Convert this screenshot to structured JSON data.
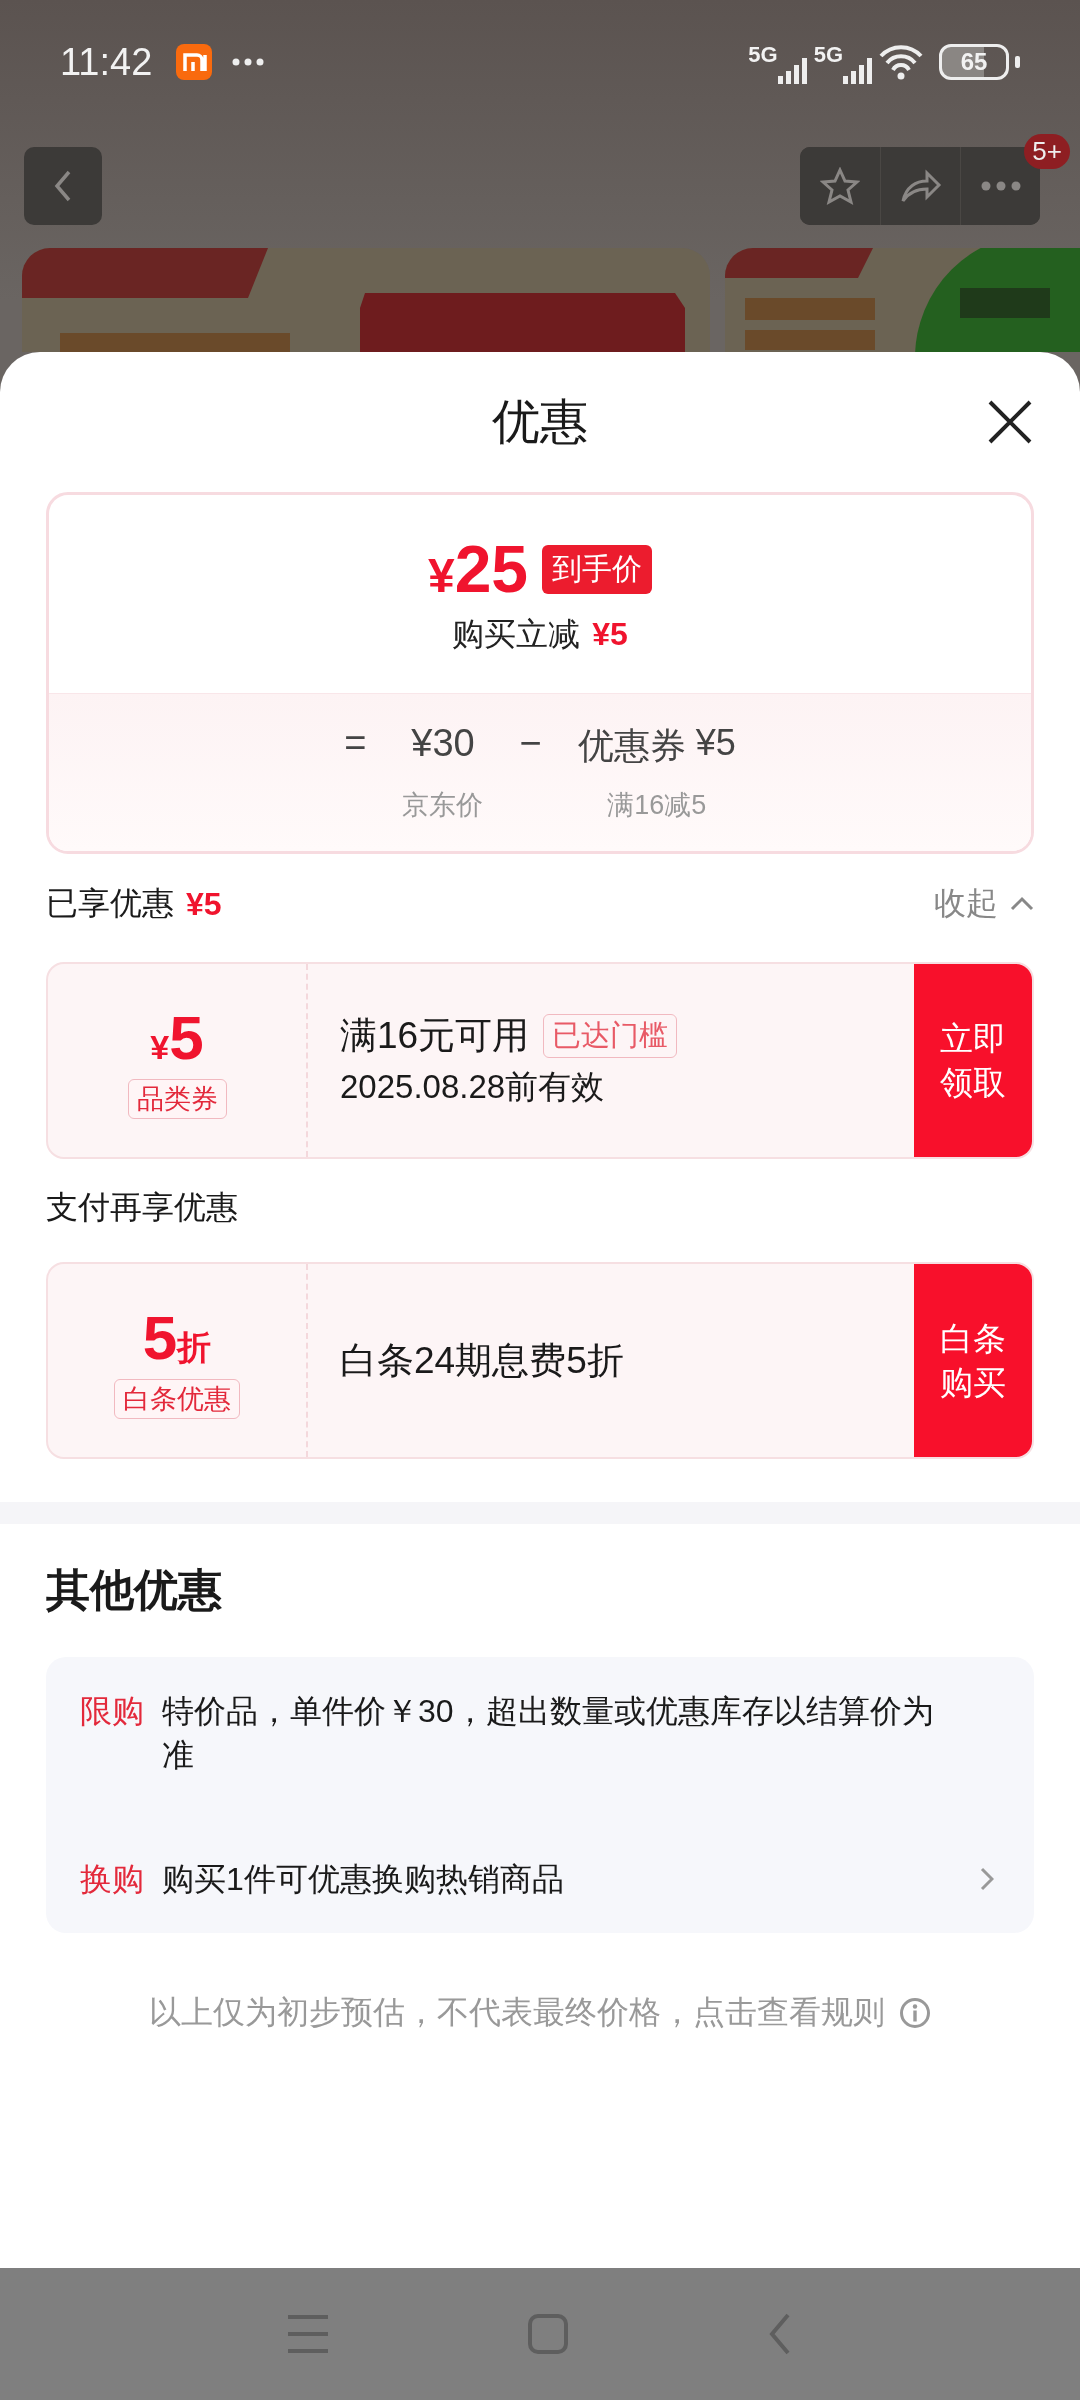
{
  "status_bar": {
    "time": "11:42",
    "networks": [
      "5G",
      "5G"
    ],
    "battery": "65"
  },
  "nav": {
    "badge": "5+"
  },
  "sheet": {
    "title": "优惠",
    "price_card": {
      "currency": "¥",
      "final_price": "25",
      "final_label": "到手价",
      "instant_label": "购买立减",
      "instant_amount": "¥5",
      "equals": "=",
      "list_price": "¥30",
      "minus": "−",
      "coupon_label": "优惠券",
      "coupon_amount": "¥5",
      "list_price_label": "京东价",
      "coupon_rule": "满16减5"
    },
    "applied": {
      "label": "已享优惠",
      "amount": "¥5",
      "toggle": "收起",
      "expanded": true
    },
    "claimed_coupons": [
      {
        "kind": "amount",
        "symbol": "¥",
        "value": "5",
        "tag": "品类券",
        "title": "满16元可用",
        "status": "已达门槛",
        "validity": "2025.08.28前有效",
        "action": "立即领取"
      }
    ],
    "pay_heading": "支付再享优惠",
    "pay_offers": [
      {
        "kind": "discount",
        "symbol": "折",
        "value": "5",
        "tag": "白条优惠",
        "title": "白条24期息费5折",
        "action": "白条购买"
      }
    ],
    "other_offers": {
      "heading": "其他优惠",
      "items": [
        {
          "tag": "限购",
          "text": "特价品，单件价￥30，超出数量或优惠库存以结算价为准",
          "link": false
        },
        {
          "tag": "换购",
          "text": "购买1件可优惠换购热销商品",
          "link": true
        }
      ]
    },
    "footnote": "以上仅为初步预估，不代表最终价格，点击查看规则"
  }
}
